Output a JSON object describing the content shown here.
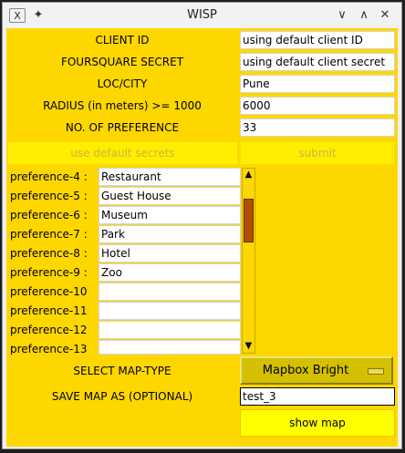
{
  "window": {
    "title": "WISP",
    "app_icon": "x-icon",
    "pin_icon": "pin-icon"
  },
  "form": {
    "client_id_label": "CLIENT ID",
    "client_id_value": "using default client ID",
    "secret_label": "FOURSQUARE SECRET",
    "secret_value": "using default client secret",
    "loc_label": "LOC/CITY",
    "loc_value": "Pune",
    "radius_label": "RADIUS (in meters) >= 1000",
    "radius_value": "6000",
    "nopref_label": "NO. OF PREFERENCE",
    "nopref_value": "33"
  },
  "buttons": {
    "default_secrets": "use default secrets",
    "submit": "submit",
    "show_map": "show map"
  },
  "preferences": [
    {
      "label": "preference-4 :",
      "value": "Restaurant"
    },
    {
      "label": "preference-5 :",
      "value": "Guest House"
    },
    {
      "label": "preference-6 :",
      "value": "Museum"
    },
    {
      "label": "preference-7 :",
      "value": "Park"
    },
    {
      "label": "preference-8 :",
      "value": "Hotel"
    },
    {
      "label": "preference-9 :",
      "value": "Zoo"
    },
    {
      "label": "preference-10 :",
      "value": ""
    },
    {
      "label": "preference-11 :",
      "value": ""
    },
    {
      "label": "preference-12 :",
      "value": ""
    },
    {
      "label": "preference-13 :",
      "value": ""
    }
  ],
  "map": {
    "type_label": "SELECT MAP-TYPE",
    "type_value": "Mapbox Bright",
    "save_label": "SAVE MAP AS (OPTIONAL)",
    "save_value": "test_3"
  },
  "colors": {
    "panel": "#ffd700",
    "disabled_button": "#ffee00",
    "dropdown": "#d4c000",
    "scroll_thumb": "#b05000"
  }
}
